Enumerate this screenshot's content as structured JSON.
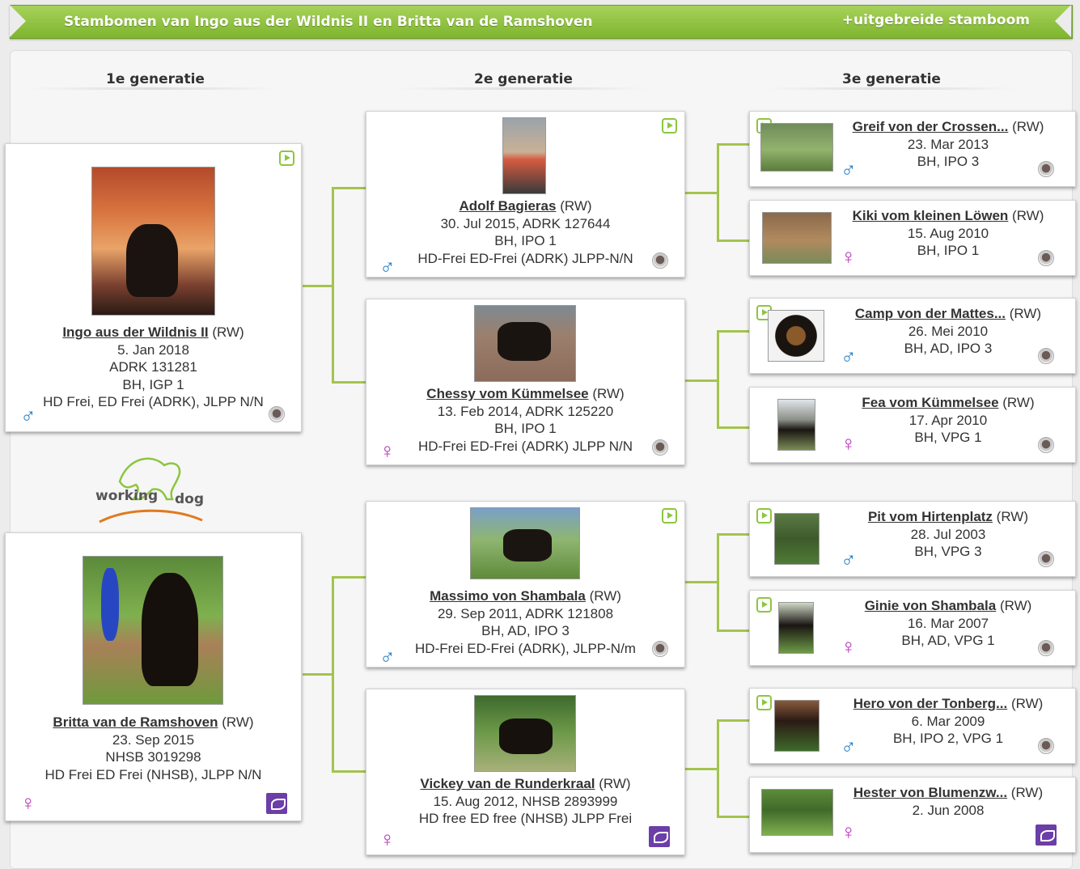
{
  "header": {
    "title": "Stambomen van Ingo aus der Wildnis II en Britta van de Ramshoven",
    "extended_link": "+uitgebreide stamboom"
  },
  "generations": [
    "1e generatie",
    "2e generatie",
    "3e generatie"
  ],
  "logo": {
    "word1": "working",
    "word2": "dog"
  },
  "dogs": {
    "ingo": {
      "name": "Ingo aus der Wildnis II",
      "tag": "(RW)",
      "line1": "5. Jan 2018",
      "line2": "ADRK 131281",
      "line3": "BH, IGP 1",
      "line4": "HD Frei, ED Frei (ADRK), JLPP N/N",
      "sex": "♂"
    },
    "britta": {
      "name": "Britta van de Ramshoven",
      "tag": "(RW)",
      "line1": "23. Sep 2015",
      "line2": "NHSB 3019298",
      "line3": "HD Frei ED Frei (NHSB), JLPP N/N",
      "sex": "♀"
    },
    "adolf": {
      "name": "Adolf Bagieras",
      "tag": "(RW)",
      "line1": "30. Jul 2015, ADRK 127644",
      "line2": "BH, IPO 1",
      "line3": "HD-Frei ED-Frei (ADRK) JLPP-N/N",
      "sex": "♂"
    },
    "chessy": {
      "name": "Chessy vom Kümmelsee",
      "tag": "(RW)",
      "line1": "13. Feb 2014, ADRK 125220",
      "line2": "BH, IPO 1",
      "line3": "HD-Frei ED-Frei (ADRK) JLPP N/N",
      "sex": "♀"
    },
    "massimo": {
      "name": "Massimo von Shambala",
      "tag": "(RW)",
      "line1": "29. Sep 2011, ADRK 121808",
      "line2": "BH, AD, IPO 3",
      "line3": "HD-Frei ED-Frei (ADRK), JLPP-N/m",
      "sex": "♂"
    },
    "vickey": {
      "name": "Vickey van de Runderkraal",
      "tag": "(RW)",
      "line1": "15. Aug 2012, NHSB 2893999",
      "line2": "HD free ED free (NHSB) JLPP Frei",
      "sex": "♀"
    },
    "greif": {
      "name": "Greif von der Crossen...",
      "tag": "(RW)",
      "line1": "23. Mar 2013",
      "line2": "BH, IPO 3",
      "sex": "♂"
    },
    "kiki": {
      "name": "Kiki vom kleinen Löwen",
      "tag": "(RW)",
      "line1": "15. Aug 2010",
      "line2": "BH, IPO 1",
      "sex": "♀"
    },
    "camp": {
      "name": "Camp von der Mattes...",
      "tag": "(RW)",
      "line1": "26. Mei 2010",
      "line2": "BH, AD, IPO 3",
      "sex": "♂"
    },
    "fea": {
      "name": "Fea vom Kümmelsee",
      "tag": "(RW)",
      "line1": "17. Apr 2010",
      "line2": "BH, VPG 1",
      "sex": "♀"
    },
    "pit": {
      "name": "Pit vom Hirtenplatz",
      "tag": "(RW)",
      "line1": "28. Jul 2003",
      "line2": "BH, VPG 3",
      "sex": "♂"
    },
    "ginie": {
      "name": "Ginie von Shambala",
      "tag": "(RW)",
      "line1": "16. Mar 2007",
      "line2": "BH, AD, VPG 1",
      "sex": "♀"
    },
    "hero": {
      "name": "Hero von der Tonberg...",
      "tag": "(RW)",
      "line1": "6. Mar 2009",
      "line2": "BH, IPO 2, VPG 1",
      "sex": "♂"
    },
    "hester": {
      "name": "Hester von Blumenzw...",
      "tag": "(RW)",
      "line1": "2. Jun 2008",
      "sex": "♀"
    }
  },
  "colors": {
    "accent": "#8cc63f",
    "male": "#1e7cc4",
    "female": "#b62fb8"
  }
}
